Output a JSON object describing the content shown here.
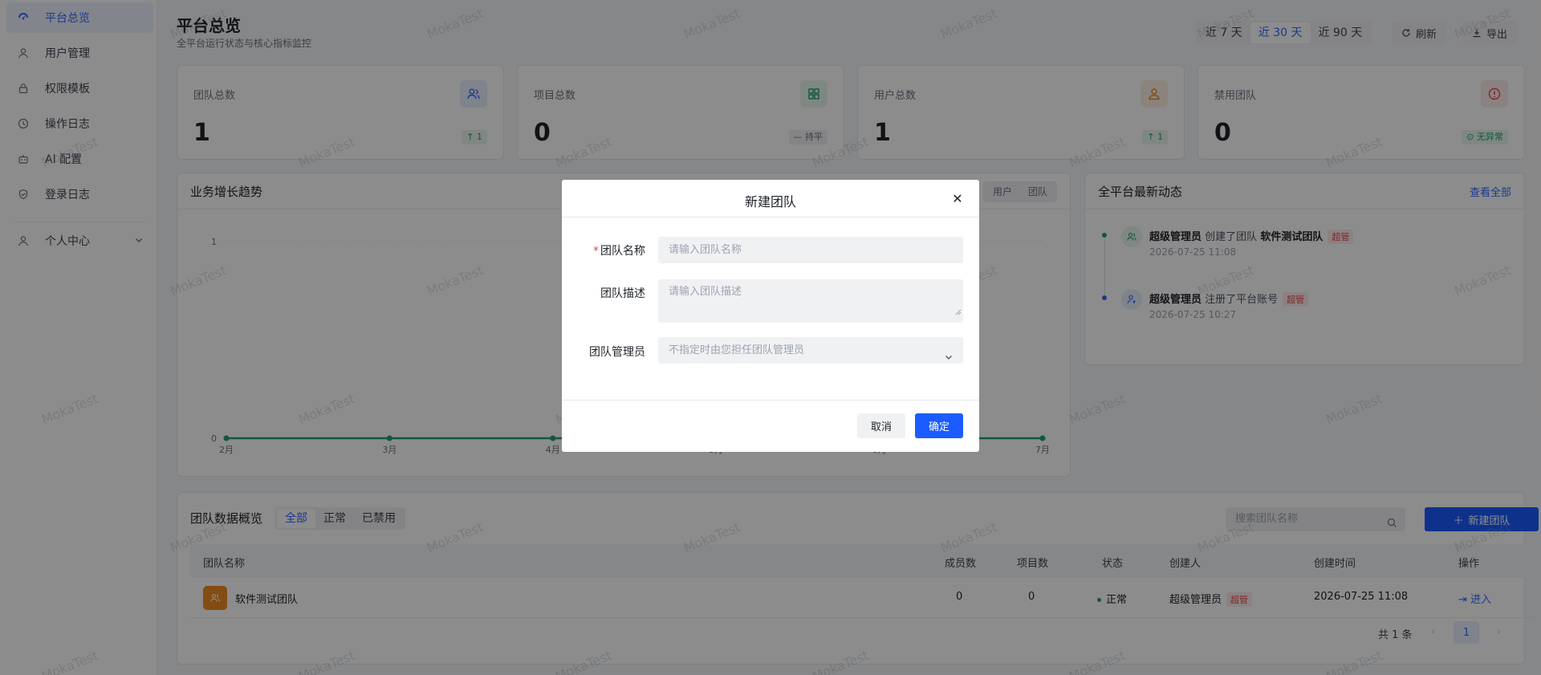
{
  "sidebar": {
    "items": [
      {
        "label": "平台总览",
        "icon": "dashboard-icon"
      },
      {
        "label": "用户管理",
        "icon": "user-icon"
      },
      {
        "label": "权限模板",
        "icon": "lock-icon"
      },
      {
        "label": "操作日志",
        "icon": "history-icon"
      },
      {
        "label": "AI 配置",
        "icon": "robot-icon"
      },
      {
        "label": "登录日志",
        "icon": "shield-icon"
      },
      {
        "label": "个人中心",
        "icon": "user-icon"
      }
    ]
  },
  "header": {
    "title": "平台总览",
    "subtitle": "全平台运行状态与核心指标监控",
    "ranges": [
      "近 7 天",
      "近 30 天",
      "近 90 天"
    ],
    "active_range": "近 30 天",
    "refresh_label": "刷新",
    "export_label": "导出"
  },
  "stats": [
    {
      "label": "团队总数",
      "value": "1",
      "badge": "↑ 1",
      "icon": "team-icon",
      "color": "#3366ff"
    },
    {
      "label": "项目总数",
      "value": "0",
      "badge": "— 持平",
      "icon": "grid-icon",
      "color": "#22a06b"
    },
    {
      "label": "用户总数",
      "value": "1",
      "badge": "↑ 1",
      "icon": "user-icon",
      "color": "#f08a24"
    },
    {
      "label": "禁用团队",
      "value": "0",
      "badge": "⊙ 无异常",
      "icon": "alert-icon",
      "color": "#e5484d"
    }
  ],
  "growth": {
    "title": "业务增长趋势",
    "tabs": [
      "用户",
      "团队"
    ]
  },
  "chart_data": {
    "type": "line",
    "title": "业务增长趋势",
    "categories": [
      "2月",
      "3月",
      "4月",
      "5月",
      "6月",
      "7月"
    ],
    "series": [
      {
        "values": [
          0,
          0,
          0,
          0,
          0,
          0
        ]
      }
    ],
    "ylim": [
      0,
      1
    ],
    "yticks": [
      "0",
      "1"
    ],
    "color": "#22a06b"
  },
  "feed": {
    "title": "全平台最新动态",
    "view_all": "查看全部",
    "items": [
      {
        "actor": "超级管理员",
        "action": "创建了团队",
        "target": "软件测试团队",
        "tag": "超管",
        "time": "2026-07-25 11:08"
      },
      {
        "actor": "超级管理员",
        "action": "注册了平台账号",
        "target": "",
        "tag": "超管",
        "time": "2026-07-25 10:27"
      }
    ]
  },
  "teams": {
    "title": "团队数据概览",
    "tabs": [
      "全部",
      "正常",
      "已禁用"
    ],
    "search_placeholder": "搜索团队名称",
    "new_button": "新建团队",
    "columns": [
      "团队名称",
      "成员数",
      "项目数",
      "状态",
      "创建人",
      "创建时间",
      "操作"
    ],
    "rows": [
      {
        "name": "软件测试团队",
        "members": "0",
        "projects": "0",
        "status": "正常",
        "creator": "超级管理员",
        "creator_tag": "超管",
        "created": "2026-07-25 11:08",
        "action": "进入"
      }
    ],
    "total": "共 1 条",
    "page": "1"
  },
  "watermark": "MokaTest",
  "modal": {
    "title": "新建团队",
    "fields": [
      {
        "label": "团队名称",
        "required": true,
        "placeholder": "请输入团队名称"
      },
      {
        "label": "团队描述",
        "required": false,
        "placeholder": "请输入团队描述"
      },
      {
        "label": "团队管理员",
        "required": false,
        "placeholder": "不指定时由您担任团队管理员"
      }
    ],
    "cancel": "取消",
    "ok": "确定"
  }
}
